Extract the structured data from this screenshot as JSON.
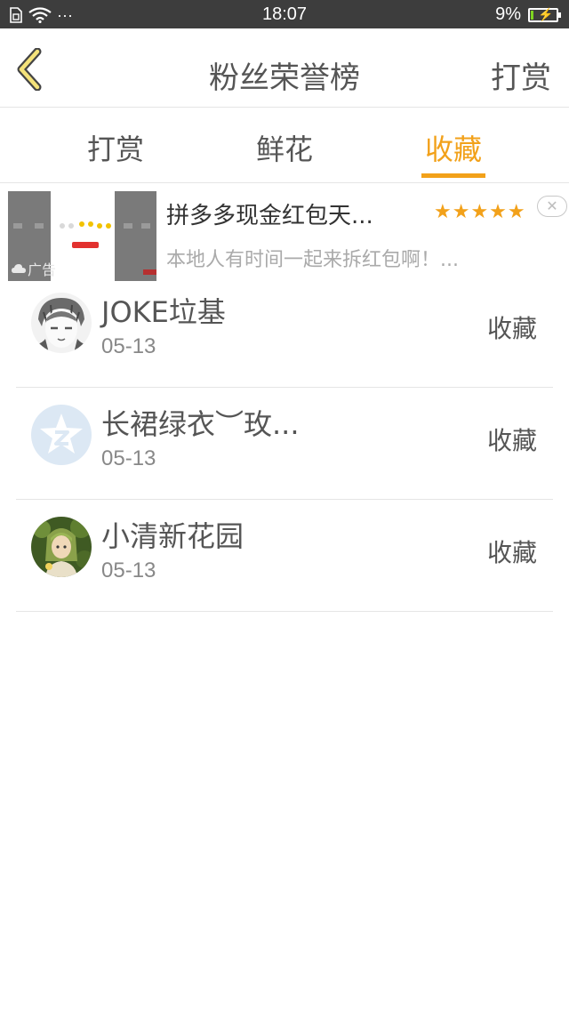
{
  "status_bar": {
    "time": "18:07",
    "battery_percent": "9%",
    "battery_level": 0.09,
    "more_indicator": "···"
  },
  "header": {
    "title": "粉丝荣誉榜",
    "action_label": "打赏"
  },
  "tabs": [
    {
      "label": "打赏",
      "active": false
    },
    {
      "label": "鲜花",
      "active": false
    },
    {
      "label": "收藏",
      "active": true
    }
  ],
  "ad": {
    "title": "拼多多现金红包天...",
    "description": "本地人有时间一起来拆红包啊！...",
    "rating_stars": "★★★★★",
    "rating": 4.5,
    "tag": "广告",
    "close_symbol": "✕"
  },
  "list": [
    {
      "name": "JOKE垃基",
      "date": "05-13",
      "action": "收藏",
      "avatar": "sketch-face-avatar"
    },
    {
      "name": "长裙绿衣︶玫...",
      "date": "05-13",
      "action": "收藏",
      "avatar": "qq-logo-avatar"
    },
    {
      "name": "小清新花园",
      "date": "05-13",
      "action": "收藏",
      "avatar": "green-girl-avatar"
    }
  ],
  "colors": {
    "accent": "#f2a11a",
    "status_bar": "#3d3d3d",
    "text": "#555555",
    "divider": "#e5e5e5"
  }
}
